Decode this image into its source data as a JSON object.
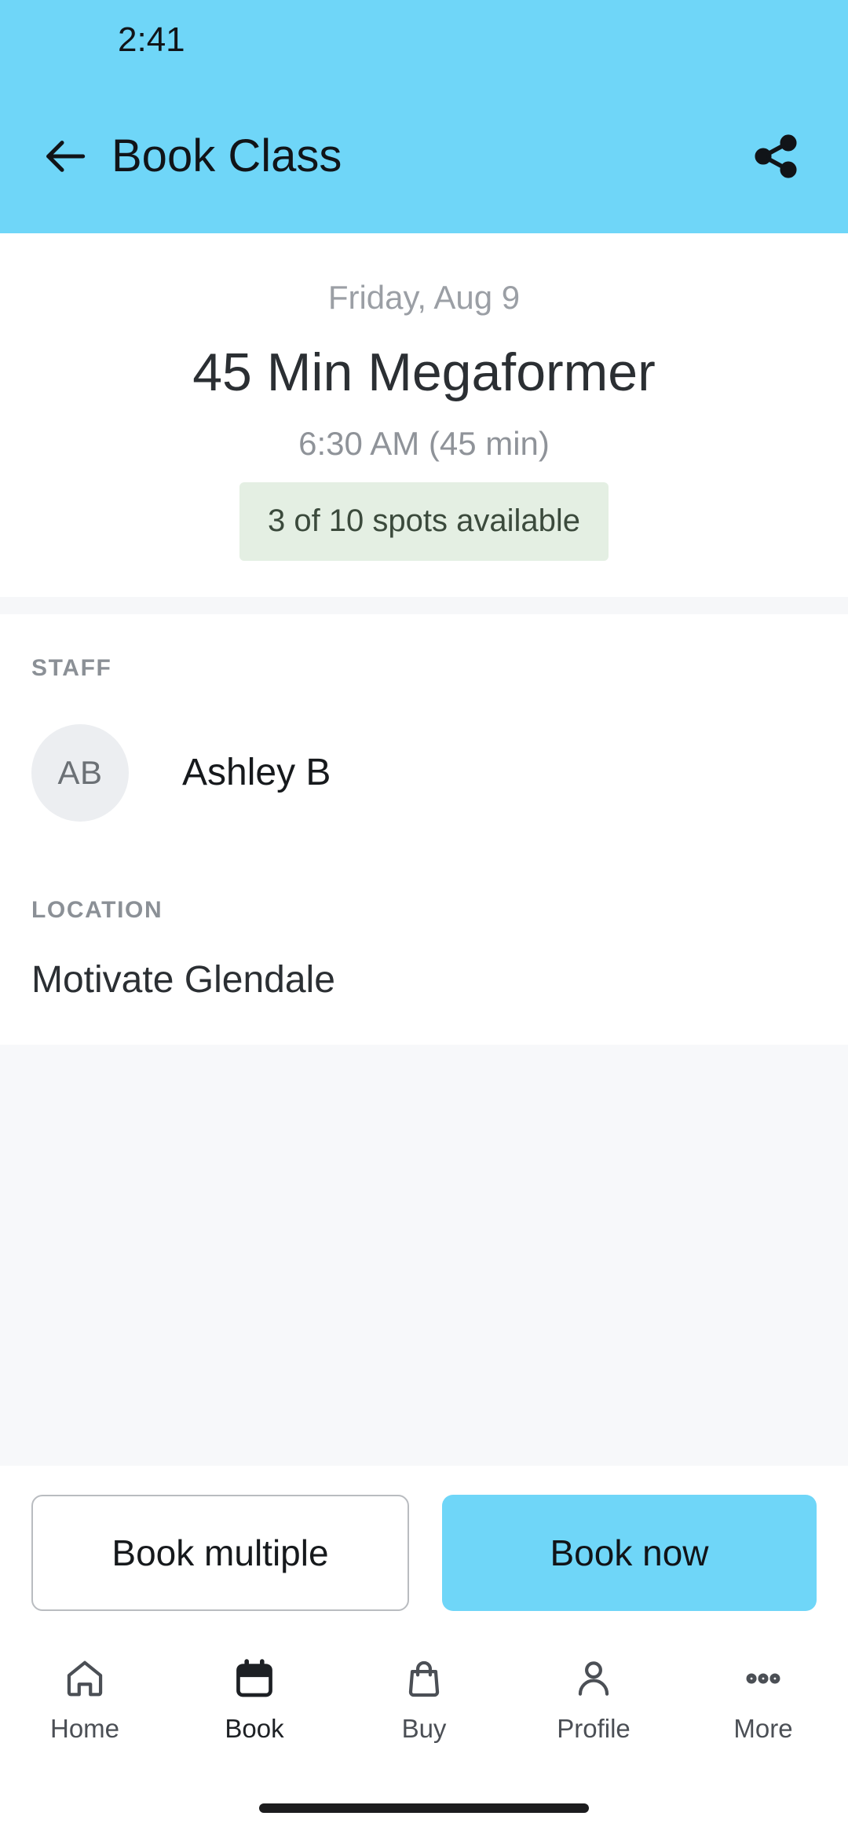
{
  "theme": {
    "accent": "#6FD6F8",
    "badge_bg": "#e4efe3",
    "badge_text": "#3b4a3c",
    "page_bg": "#ffffff",
    "filler_bg": "#f7f8fa",
    "muted_text": "#9b9fa5"
  },
  "status_bar": {
    "time": "2:41"
  },
  "app_bar": {
    "title": "Book Class",
    "back_icon": "arrow-left-icon",
    "share_icon": "share-icon"
  },
  "hero": {
    "date": "Friday, Aug 9",
    "class_name": "45 Min Megaformer",
    "time_and_duration": "6:30 AM (45 min)",
    "spots_badge": "3 of 10 spots available",
    "spots_available": 3,
    "spots_total": 10
  },
  "details": {
    "staff_label": "STAFF",
    "staff": {
      "initials": "AB",
      "name": "Ashley B"
    },
    "location_label": "LOCATION",
    "location": "Motivate Glendale"
  },
  "actions": {
    "secondary_label": "Book multiple",
    "primary_label": "Book now"
  },
  "bottom_nav": {
    "items": [
      {
        "label": "Home",
        "icon": "home-icon",
        "active": false
      },
      {
        "label": "Book",
        "icon": "calendar-icon",
        "active": true
      },
      {
        "label": "Buy",
        "icon": "bag-icon",
        "active": false
      },
      {
        "label": "Profile",
        "icon": "person-icon",
        "active": false
      },
      {
        "label": "More",
        "icon": "more-dots-icon",
        "active": false
      }
    ]
  }
}
